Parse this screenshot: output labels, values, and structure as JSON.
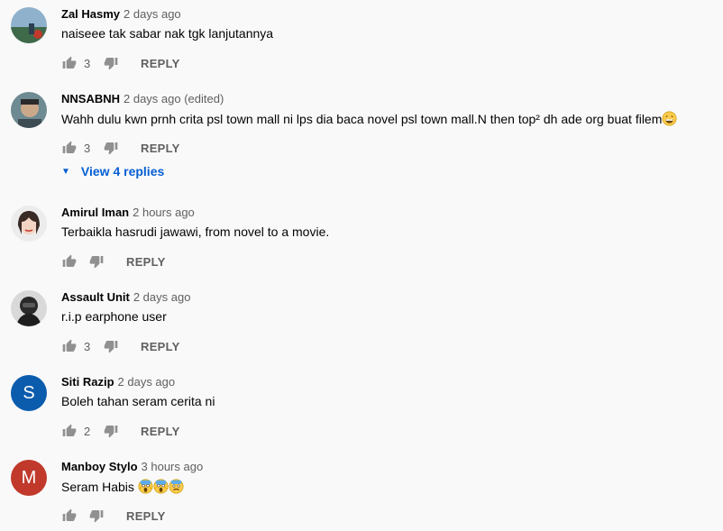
{
  "comments": [
    {
      "author": "Zal Hasmy",
      "time": "2 days ago",
      "text": "naiseee tak sabar nak tgk lanjutannya",
      "likes": "3",
      "reply": "REPLY"
    },
    {
      "author": "NNSABNH",
      "time": "2 days ago (edited)",
      "text": "Wahh dulu kwn prnh crita psl town mall ni lps dia baca novel psl town mall.N then top² dh ade org buat filem",
      "likes": "3",
      "reply": "REPLY",
      "replies_label": "View 4 replies"
    },
    {
      "author": "Amirul Iman",
      "time": "2 hours ago",
      "text": "Terbaikla hasrudi jawawi, from novel to a movie.",
      "likes": "",
      "reply": "REPLY"
    },
    {
      "author": "Assault Unit",
      "time": "2 days ago",
      "text": "r.i.p earphone user",
      "likes": "3",
      "reply": "REPLY"
    },
    {
      "author": "Siti Razip",
      "time": "2 days ago",
      "text": "Boleh tahan seram cerita ni",
      "likes": "2",
      "reply": "REPLY",
      "avatar_letter": "S",
      "avatar_color": "#0b5cad"
    },
    {
      "author": "Manboy Stylo",
      "time": "3 hours ago",
      "text": "Seram Habis",
      "likes": "",
      "reply": "REPLY",
      "avatar_letter": "M",
      "avatar_color": "#c0392b"
    }
  ],
  "colors": {
    "link": "#065fd4",
    "meta": "#606060",
    "background": "#f9f9f9"
  },
  "icons": [
    "thumb-up-icon",
    "thumb-down-icon",
    "caret-down-icon",
    "grin-emoji-icon",
    "scream-emoji-icon",
    "fearful-emoji-icon"
  ]
}
